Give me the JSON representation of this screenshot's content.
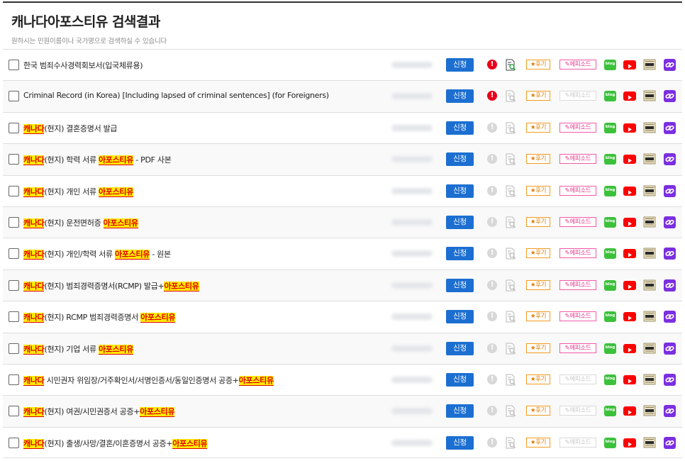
{
  "header": {
    "title": "캐나다아포스티유 검색결과",
    "subtitle": "원하시는 민원이름이나 국가명으로 검색하실 수 있습니다"
  },
  "colors": {
    "apply_blue": "#1c6fd1",
    "highlight_bg": "#ffea00",
    "highlight_text": "#e00000",
    "alert_red": "#e8001c",
    "review_orange": "#f39a1f",
    "episode_pink": "#f25aa9",
    "blog_green": "#3cc13b",
    "youtube_red": "#ff0000",
    "link_purple": "#7b2fe0"
  },
  "labels": {
    "apply": "신청",
    "alert": "!",
    "review": "★후기",
    "episode": "✎에피소드",
    "blog": "blog"
  },
  "icons": {
    "alert": "exclamation-circle-icon",
    "docsearch": "document-search-icon",
    "blog": "blog-icon",
    "youtube": "youtube-icon",
    "news": "news-icon",
    "link": "link-icon"
  },
  "rows": [
    {
      "parts": [
        {
          "t": "한국 범죄수사경력회보서(입국체류용)"
        }
      ],
      "alert_active": true,
      "doc_active": true,
      "episode_active": true
    },
    {
      "parts": [
        {
          "t": "Criminal Record (in Korea) [Including lapsed of criminal sentences] (for Foreigners)"
        }
      ],
      "alert_active": true,
      "doc_active": false,
      "episode_active": false
    },
    {
      "parts": [
        {
          "t": "캐나다",
          "hl": true
        },
        {
          "t": "(현지) 결혼증명서 발급"
        }
      ],
      "alert_active": false,
      "doc_active": false,
      "episode_active": true
    },
    {
      "parts": [
        {
          "t": "캐나다",
          "hl": true
        },
        {
          "t": "(현지) 학력 서류 "
        },
        {
          "t": "아포스티유",
          "hl": true
        },
        {
          "t": " - PDF 사본"
        }
      ],
      "alert_active": false,
      "doc_active": false,
      "episode_active": true
    },
    {
      "parts": [
        {
          "t": "캐나다",
          "hl": true
        },
        {
          "t": "(현지) 개인 서류 "
        },
        {
          "t": "아포스티유",
          "hl": true
        }
      ],
      "alert_active": false,
      "doc_active": false,
      "episode_active": true
    },
    {
      "parts": [
        {
          "t": "캐나다",
          "hl": true
        },
        {
          "t": "(현지) 운전면허증 "
        },
        {
          "t": "아포스티유",
          "hl": true
        }
      ],
      "alert_active": false,
      "doc_active": false,
      "episode_active": true
    },
    {
      "parts": [
        {
          "t": "캐나다",
          "hl": true
        },
        {
          "t": "(현지) 개인/학력 서류 "
        },
        {
          "t": "아포스티유",
          "hl": true
        },
        {
          "t": " - 원본"
        }
      ],
      "alert_active": false,
      "doc_active": false,
      "episode_active": true
    },
    {
      "parts": [
        {
          "t": "캐나다",
          "hl": true
        },
        {
          "t": "(현지) 범죄경력증명서(RCMP) 발급+"
        },
        {
          "t": "아포스티유",
          "hl": true
        }
      ],
      "alert_active": false,
      "doc_active": false,
      "episode_active": true
    },
    {
      "parts": [
        {
          "t": "캐나다",
          "hl": true
        },
        {
          "t": "(현지) RCMP 범죄경력증명서 "
        },
        {
          "t": "아포스티유",
          "hl": true
        }
      ],
      "alert_active": false,
      "doc_active": false,
      "episode_active": true
    },
    {
      "parts": [
        {
          "t": "캐나다",
          "hl": true
        },
        {
          "t": "(현지) 기업 서류 "
        },
        {
          "t": "아포스티유",
          "hl": true
        }
      ],
      "alert_active": false,
      "doc_active": false,
      "episode_active": true
    },
    {
      "parts": [
        {
          "t": "캐나다",
          "hl": true
        },
        {
          "t": " 시민권자 위임장/거주확인서/서명인증서/동일인증명서 공증+"
        },
        {
          "t": "아포스티유",
          "hl": true
        }
      ],
      "alert_active": false,
      "doc_active": false,
      "episode_active": false
    },
    {
      "parts": [
        {
          "t": "캐나다",
          "hl": true
        },
        {
          "t": "(현지) 여권/시민권증서 공증+"
        },
        {
          "t": "아포스티유",
          "hl": true
        }
      ],
      "alert_active": false,
      "doc_active": false,
      "episode_active": false
    },
    {
      "parts": [
        {
          "t": "캐나다",
          "hl": true
        },
        {
          "t": "(현지) 출생/사망/결혼/이혼증명서 공증+"
        },
        {
          "t": "아포스티유",
          "hl": true
        }
      ],
      "alert_active": false,
      "doc_active": false,
      "episode_active": false
    }
  ]
}
